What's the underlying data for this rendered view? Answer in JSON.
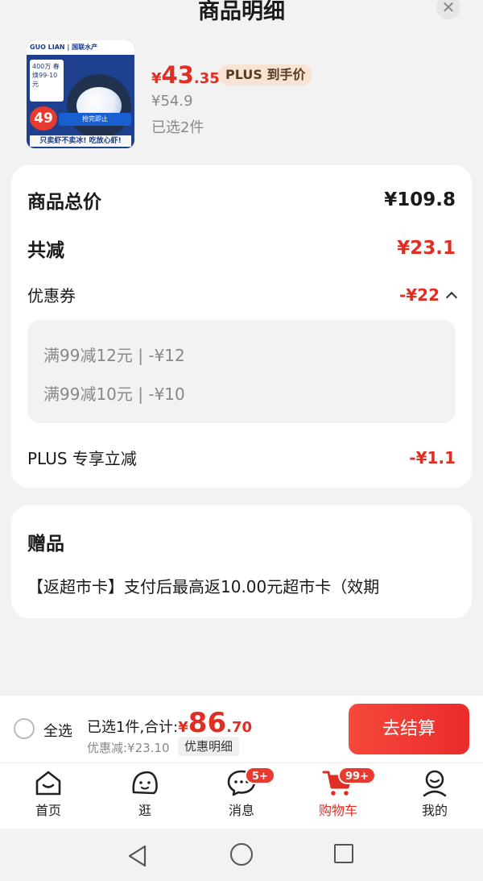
{
  "sheet": {
    "title": "商品明细",
    "close_icon": "close-icon"
  },
  "product": {
    "thumb_brand": "GUO LIAN | 国联水产",
    "thumb_tag": "400万 春焕99-10元",
    "thumb_price": "49",
    "thumb_strip": "抢完即止",
    "thumb_slogan": "只卖虾不卖冰! 吃放心虾!",
    "price_symbol": "¥",
    "price_integer": "43",
    "price_decimal": ".35",
    "plus_tag": "PLUS 到手价",
    "original_price": "¥54.9",
    "selected_count": "已选2件"
  },
  "summary": {
    "total_label": "商品总价",
    "total_value": "¥109.8",
    "reduce_label": "共减",
    "reduce_value": "¥23.1",
    "coupon_label": "优惠券",
    "coupon_value": "-¥22",
    "coupons": [
      "满99减12元 | -¥12",
      "满99减10元 | -¥10"
    ],
    "plus_label": "PLUS 专享立减",
    "plus_value": "-¥1.1"
  },
  "gift": {
    "title": "赠品",
    "description": "【返超市卡】支付后最高返10.00元超市卡（效期"
  },
  "checkout": {
    "select_all": "全选",
    "sum_prefix": "已选1件,合计:",
    "sum_symbol": "¥",
    "sum_integer": "86",
    "sum_decimal": ".70",
    "discount_text": "优惠减:¥23.10",
    "detail_button": "优惠明细",
    "checkout_button": "去结算"
  },
  "tabbar": {
    "tabs": [
      {
        "label": "首页",
        "icon": "home-icon"
      },
      {
        "label": "逛",
        "icon": "browse-icon"
      },
      {
        "label": "消息",
        "icon": "message-icon",
        "badge": "5+"
      },
      {
        "label": "购物车",
        "icon": "cart-icon",
        "badge": "99+",
        "active": true
      },
      {
        "label": "我的",
        "icon": "profile-icon"
      }
    ]
  },
  "colors": {
    "accent": "#e02e24",
    "background": "#f2f2f2",
    "card": "#ffffff"
  }
}
